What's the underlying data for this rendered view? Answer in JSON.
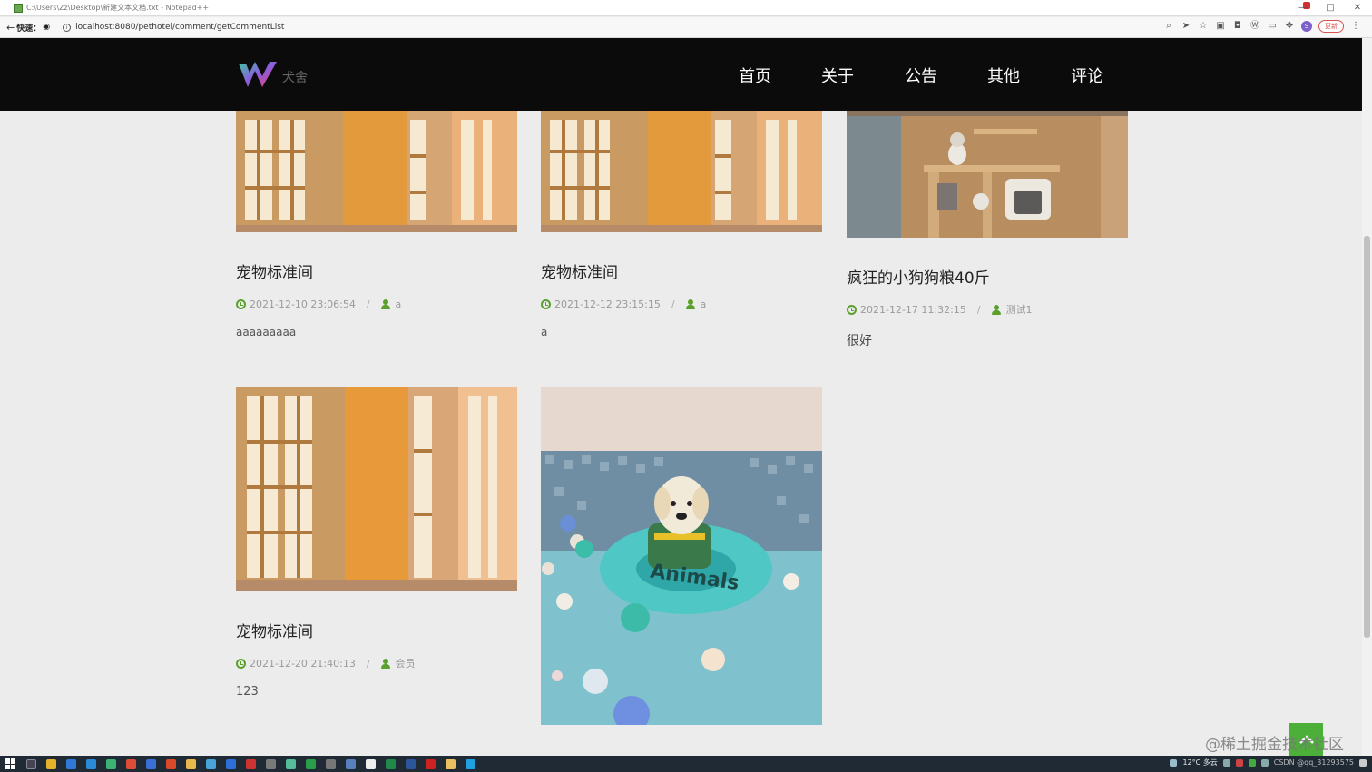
{
  "window": {
    "title": "C:\\Users\\Zz\\Desktop\\新建文本文档.txt - Notepad++",
    "minimize": "—",
    "maximize": "□",
    "close": "✕"
  },
  "browser": {
    "back_label": "←",
    "translate_label": "快速：",
    "url": "localhost:8080/pethotel/comment/getCommentList",
    "update_label": "更新",
    "avatar_label": "S"
  },
  "site": {
    "logo_text": "犬舍",
    "nav": [
      "首页",
      "关于",
      "公告",
      "其他",
      "评论"
    ]
  },
  "comments": [
    {
      "title": "宠物标准间",
      "date": "2021-12-10 23:06:54",
      "user": "a",
      "body": "aaaaaaaaa",
      "image": "cabinet-room"
    },
    {
      "title": "宠物标准间",
      "date": "2021-12-12 23:15:15",
      "user": "a",
      "body": "a",
      "image": "cabinet-room"
    },
    {
      "title": "疯狂的小狗狗粮40斤",
      "date": "2021-12-17 11:32:15",
      "user": "测试1",
      "body": "很好",
      "image": "cat-room"
    },
    {
      "title": "宠物标准间",
      "date": "2021-12-20 21:40:13",
      "user": "会员",
      "body": "123",
      "image": "cabinet-room"
    },
    {
      "title": "",
      "date": "",
      "user": "",
      "body": "",
      "image": "dog-pool"
    }
  ],
  "meta_separator": "/",
  "watermark": "@稀土掘金技术社区",
  "taskbar": {
    "weather": "12°C 多云",
    "tray_text": "CSDN @qq_31293575"
  },
  "colors": {
    "header_bg": "#0b0b0b",
    "accent_green": "#5aa02c",
    "back_to_top": "#4caf3a",
    "page_bg": "#ececec"
  }
}
